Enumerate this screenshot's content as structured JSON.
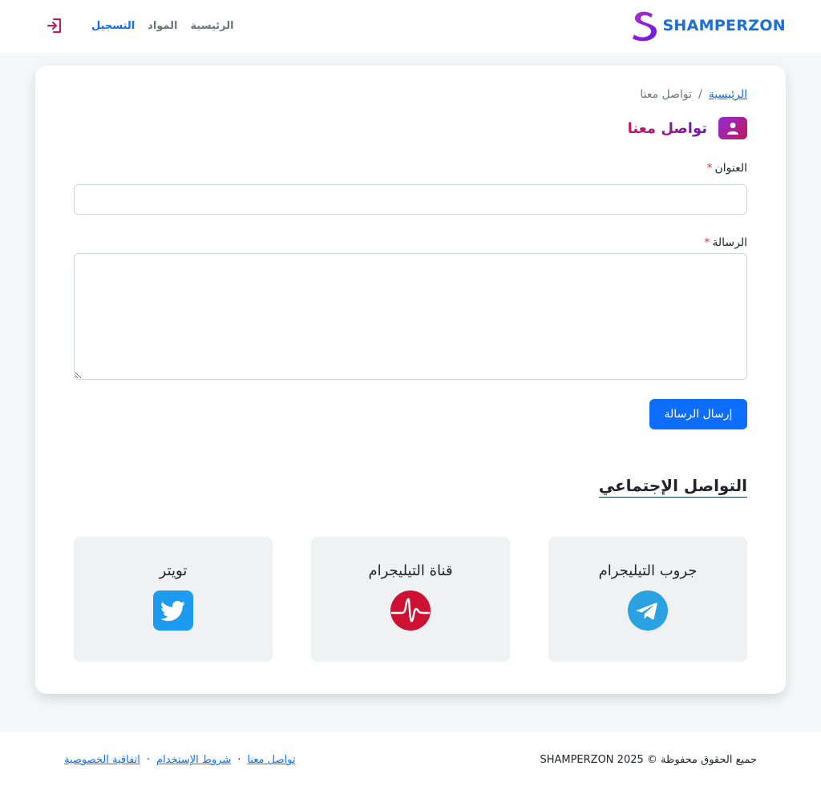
{
  "navbar": {
    "brand_name": "SHAMPERZON",
    "links": [
      {
        "label": "الرئيسية"
      },
      {
        "label": "المواد"
      },
      {
        "label": "التسجيل"
      }
    ],
    "login_icon": "login-icon"
  },
  "breadcrumb": {
    "home": "الرئيسية",
    "separator": "/",
    "current": "تواصل معنا"
  },
  "page_title": "تواصل معنا",
  "form": {
    "subject_label": "العنوان",
    "subject_value": "",
    "message_label": "الرسالة",
    "message_value": "",
    "required_mark": "*",
    "submit_label": "إرسال الرسالة"
  },
  "social": {
    "title": "التواصل الإجتماعي",
    "cards": [
      {
        "label": "جروب التيليجرام",
        "icon": "telegram-icon"
      },
      {
        "label": "قناة التيليجرام",
        "icon": "telegram-channel-icon"
      },
      {
        "label": "تويتر",
        "icon": "twitter-icon"
      }
    ]
  },
  "footer": {
    "copyright": "جميع الحقوق محفوظة © 2025 SHAMPERZON",
    "links": [
      {
        "label": "تواصل معنا"
      },
      {
        "label": "شروط الإستخدام"
      },
      {
        "label": "اتفاقية الخصوصية"
      }
    ],
    "dot": "·"
  },
  "colors": {
    "primary": "#0d6efd",
    "brand": "#1a6fd8",
    "telegram": "#2aa1e1",
    "twitter": "#1d9bf0",
    "channel": "#cc1133"
  }
}
